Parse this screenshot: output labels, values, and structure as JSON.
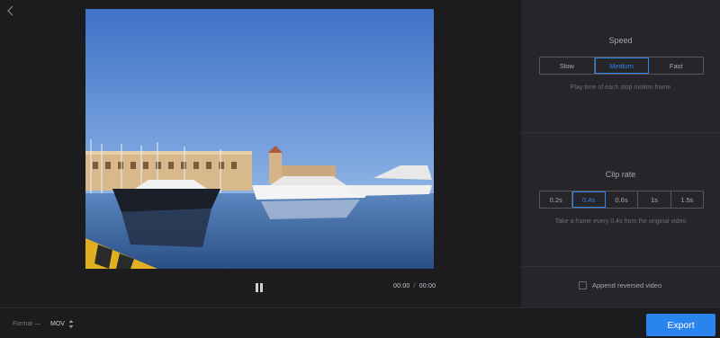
{
  "player": {
    "current_time": "00:00",
    "separator": "/",
    "duration": "00:00",
    "pause_icon": "pause-icon",
    "back_icon": "chevron-left-icon"
  },
  "speed": {
    "title": "Speed",
    "options": [
      "Slow",
      "Medium",
      "Fast"
    ],
    "selected": "Medium",
    "hint": "Play time of each stop motion frame"
  },
  "clip_rate": {
    "title": "Clip rate",
    "options": [
      "0.2s",
      "0.4s",
      "0.6s",
      "1s",
      "1.5s"
    ],
    "selected": "0.4s",
    "hint": "Take a frame every 0.4s from the original video"
  },
  "append": {
    "label": "Append reversed video",
    "checked": false
  },
  "format": {
    "label": "Format —",
    "value": "MOV"
  },
  "export": {
    "label": "Export"
  },
  "colors": {
    "accent": "#2a84ee",
    "panel": "#26262a",
    "background": "#1c1c1f"
  }
}
